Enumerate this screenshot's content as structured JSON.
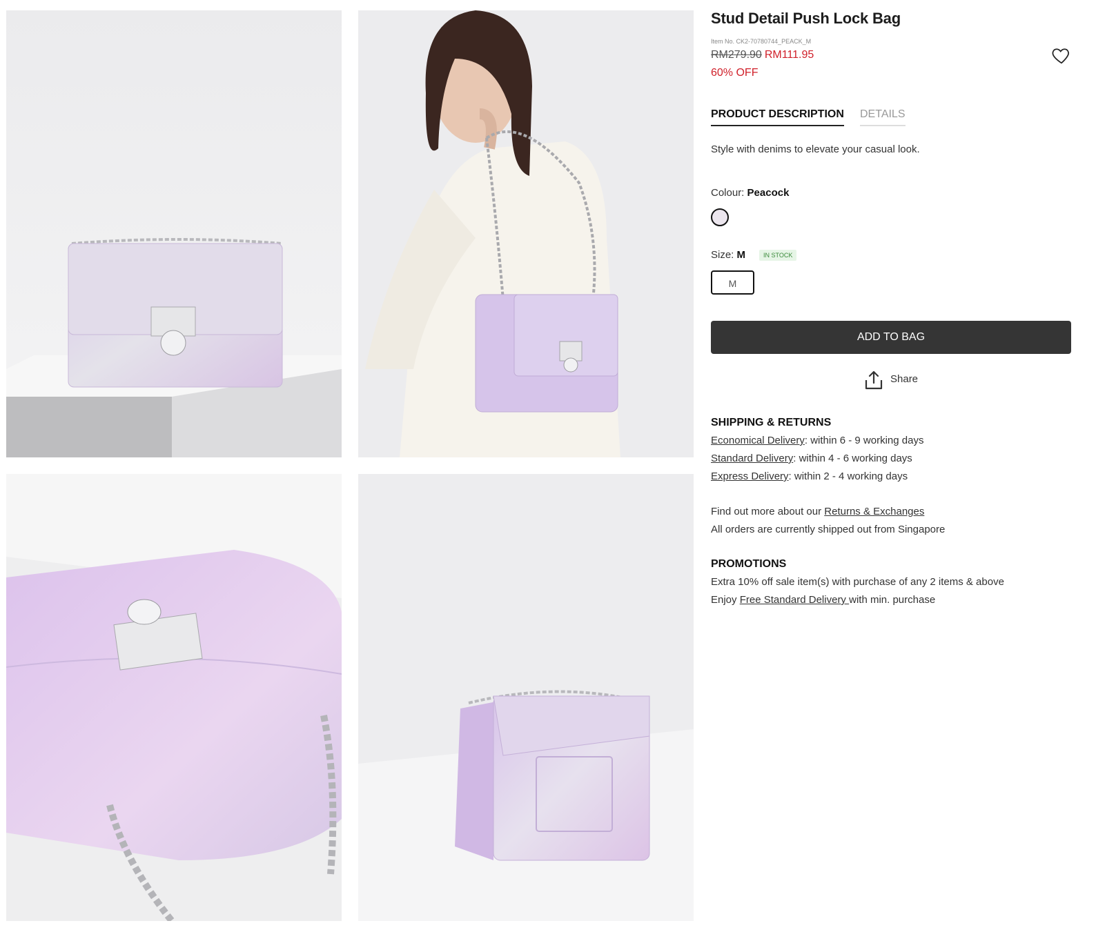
{
  "product": {
    "title": "Stud Detail Push Lock Bag",
    "item_no": "Item No. CK2-70780744_PEACK_M",
    "price_original": "RM279.90",
    "price_sale": "RM111.95",
    "discount": "60% OFF"
  },
  "tabs": {
    "description_label": "PRODUCT DESCRIPTION",
    "details_label": "DETAILS",
    "active": "PRODUCT DESCRIPTION"
  },
  "description": "Style with denims to elevate your casual look.",
  "colour": {
    "label": "Colour:",
    "value": "Peacock",
    "swatch_color": "#ece6ee"
  },
  "size": {
    "label": "Size:",
    "value": "M",
    "stock_badge": "IN STOCK",
    "options": [
      "M"
    ]
  },
  "actions": {
    "add_to_bag": "ADD TO BAG",
    "share": "Share"
  },
  "shipping": {
    "heading": "SHIPPING & RETURNS",
    "economical_link": "Economical Delivery",
    "economical_text": ": within 6 - 9 working days",
    "standard_link": "Standard Delivery",
    "standard_text": ": within 4 - 6 working days",
    "express_link": "Express Delivery",
    "express_text": ": within 2 - 4 working days",
    "returns_prefix": "Find out more about our ",
    "returns_link": "Returns & Exchanges",
    "shipped_from": "All orders are currently shipped out from Singapore"
  },
  "promotions": {
    "heading": "PROMOTIONS",
    "line1": "Extra 10% off sale item(s) with purchase of any 2 items & above",
    "line2_prefix": "Enjoy ",
    "line2_link": "Free Standard Delivery ",
    "line2_suffix": "with min. purchase"
  },
  "colors": {
    "sale_red": "#d0202a",
    "button_dark": "#353535",
    "stock_green": "#3a8a3a",
    "bag_lilac": "#d9c6e8"
  },
  "icons": [
    "heart-icon",
    "share-icon"
  ]
}
